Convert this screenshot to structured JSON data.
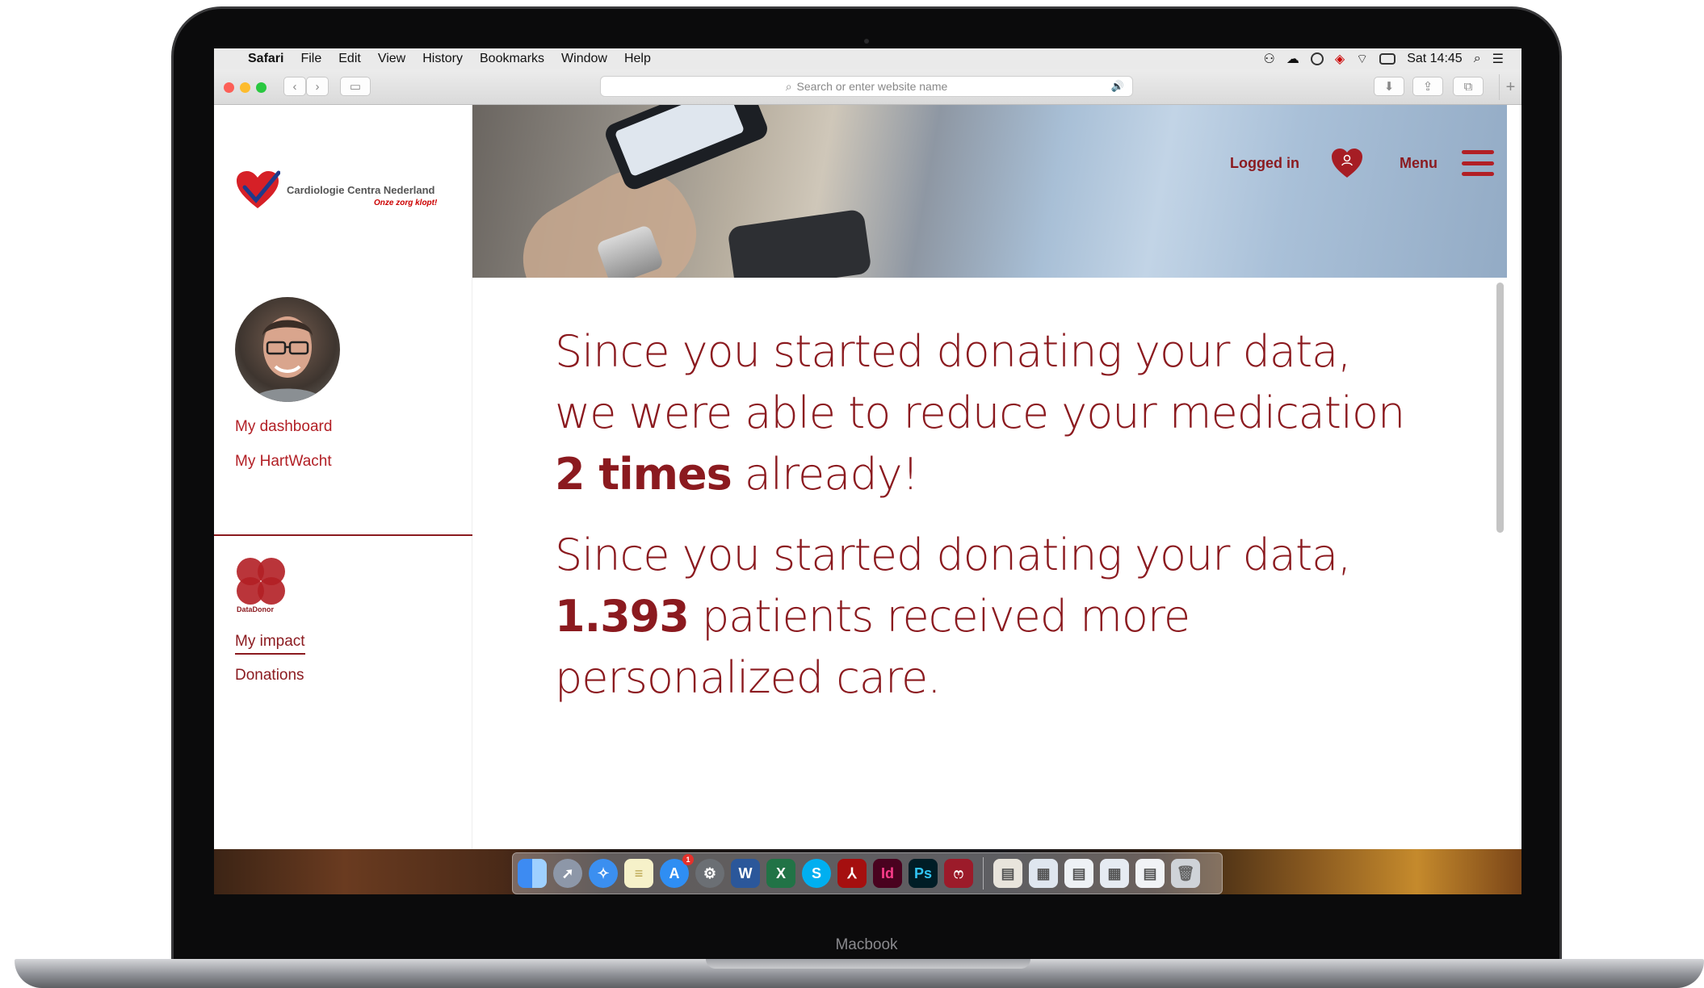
{
  "menubar": {
    "app": "Safari",
    "items": [
      "File",
      "Edit",
      "View",
      "History",
      "Bookmarks",
      "Window",
      "Help"
    ],
    "clock": "Sat 14:45"
  },
  "toolbar": {
    "url_placeholder": "Search or enter website name"
  },
  "site": {
    "logo_name": "Cardiologie Centra Nederland",
    "logo_tagline": "Onze zorg klopt!",
    "logged_in_label": "Logged in",
    "menu_label": "Menu"
  },
  "sidebar": {
    "links_top": [
      "My dashboard",
      "My HartWacht"
    ],
    "datadonor_label": "DataDonor",
    "links_bottom": [
      "My impact",
      "Donations"
    ],
    "active_link": "My impact"
  },
  "main": {
    "para1_pre": "Since you started donating your data, we were able to reduce your medication",
    "para1_bold": "2 times",
    "para1_post": "already!",
    "para2_pre": "Since you started donating your data,",
    "para2_bold": "1.393",
    "para2_post": "patients received more personalized care."
  },
  "dock": {
    "apps": [
      "finder-icon",
      "launchpad-icon",
      "safari-icon",
      "notes-icon",
      "app-store-icon",
      "system-preferences-icon",
      "word-icon",
      "excel-icon",
      "skype-icon",
      "acrobat-icon",
      "indesign-icon",
      "photoshop-icon",
      "mendeley-icon"
    ],
    "app_store_badge": "1"
  },
  "device": {
    "label": "Macbook"
  },
  "colors": {
    "brand": "#8b1a1f",
    "accent": "#b21f25"
  }
}
